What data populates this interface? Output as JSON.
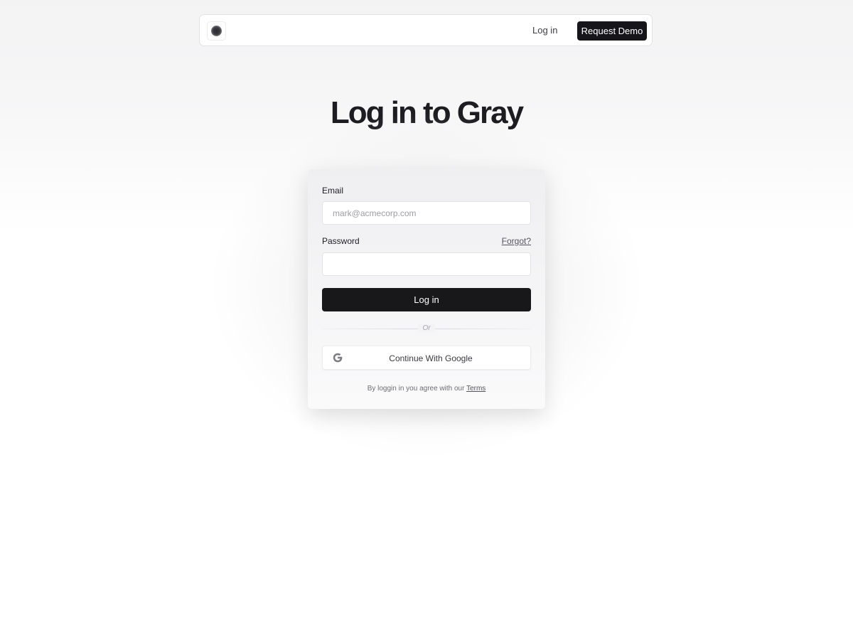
{
  "nav": {
    "logo_icon": "circle-logo-icon",
    "login_label": "Log in",
    "demo_label": "Request Demo"
  },
  "page": {
    "title": "Log in to Gray"
  },
  "form": {
    "email_label": "Email",
    "email_placeholder": "mark@acmecorp.com",
    "email_value": "",
    "password_label": "Password",
    "password_value": "",
    "forgot_label": "Forgot?",
    "login_label": "Log in",
    "or_label": "Or",
    "google_icon": "google-icon",
    "google_label": "Continue With Google",
    "terms_prefix": "By loggin in you agree with our",
    "terms_link": "Terms"
  },
  "colors": {
    "primary_button": "#18181b",
    "background": "#f3f3f4"
  }
}
